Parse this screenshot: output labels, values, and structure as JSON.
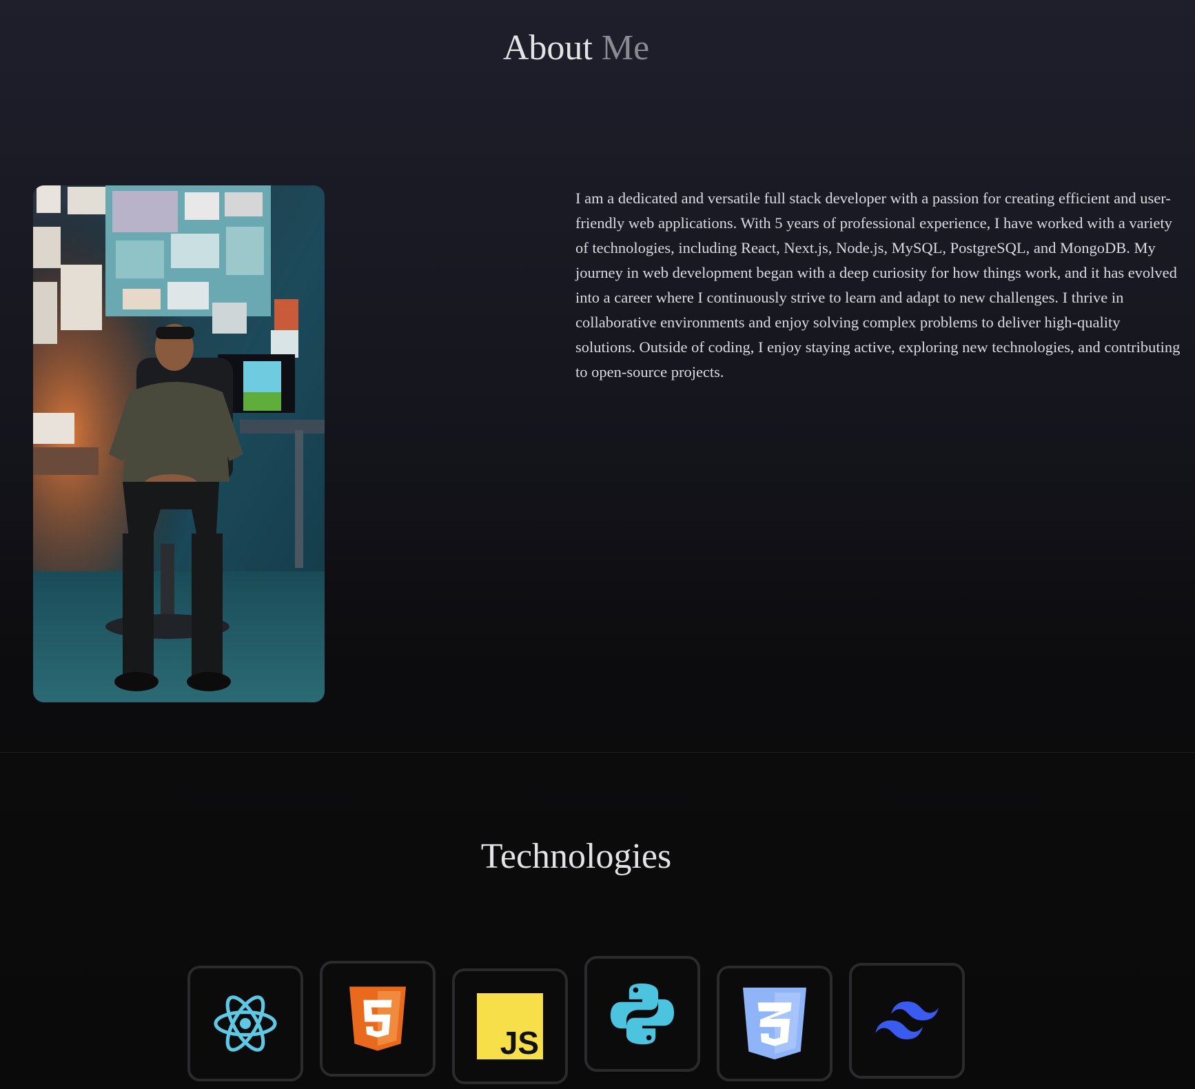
{
  "about": {
    "title_main": "About",
    "title_accent": "Me",
    "bio": "I am a dedicated and versatile full stack developer with a passion for creating efficient and user-friendly web applications. With 5 years of professional experience, I have worked with a variety of technologies, including React, Next.js, Node.js, MySQL, PostgreSQL, and MongoDB. My journey in web development began with a deep curiosity for how things work, and it has evolved into a career where I continuously strive to learn and adapt to new challenges. I thrive in collaborative environments and enjoy solving complex problems to deliver high-quality solutions. Outside of coding, I enjoy staying active, exploring new technologies, and contributing to open-source projects."
  },
  "technologies": {
    "title": "Technologies",
    "items": [
      {
        "icon": "react-icon",
        "color": "#5ec8e5"
      },
      {
        "icon": "html5-icon",
        "color": "#e96a1c"
      },
      {
        "icon": "javascript-icon",
        "color": "#f7df4a"
      },
      {
        "icon": "python-icon",
        "color": "#4cc4e0"
      },
      {
        "icon": "css3-icon",
        "color": "#8fb4f8"
      },
      {
        "icon": "tailwind-icon",
        "color": "#3a5bf0"
      }
    ]
  },
  "colors": {
    "accent_text": "#8a8a92",
    "card_border": "#2b2b2e"
  }
}
